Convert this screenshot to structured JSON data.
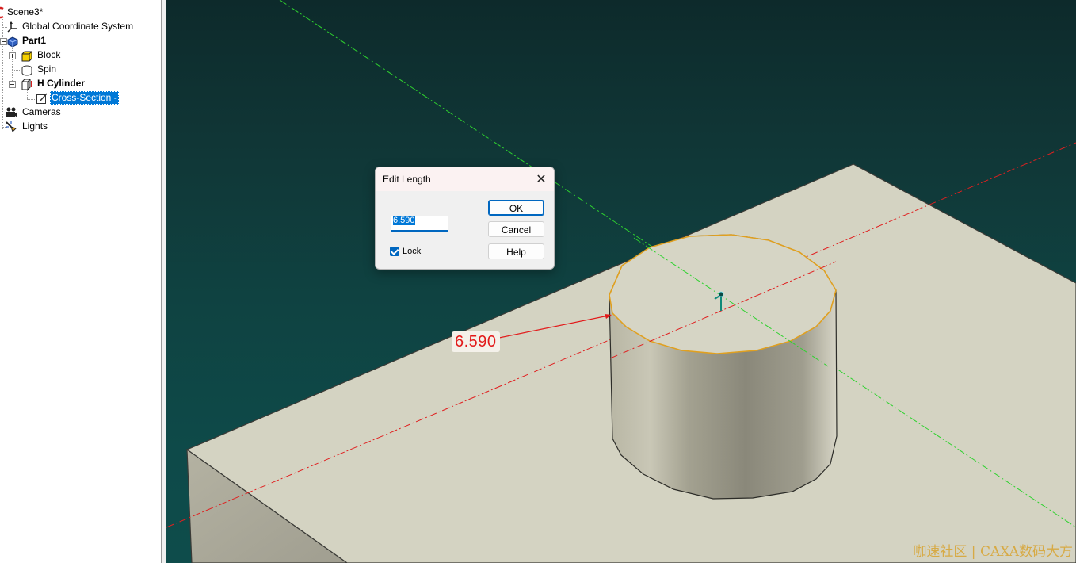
{
  "tree": {
    "items": [
      {
        "label": "Scene3*",
        "icon": "scene-icon",
        "bold": false
      },
      {
        "label": "Global Coordinate System",
        "icon": "axes-icon",
        "bold": false
      },
      {
        "label": "Part1",
        "icon": "part-icon",
        "bold": true
      },
      {
        "label": "Block",
        "icon": "block-icon",
        "bold": false
      },
      {
        "label": "Spin",
        "icon": "spin-icon",
        "bold": false
      },
      {
        "label": "H Cylinder",
        "icon": "cylinder-icon",
        "bold": true
      },
      {
        "label": "Cross-Section -",
        "icon": "sketch-icon",
        "bold": false,
        "selected": true
      },
      {
        "label": "Cameras",
        "icon": "camera-icon",
        "bold": false
      },
      {
        "label": "Lights",
        "icon": "light-icon",
        "bold": false
      }
    ]
  },
  "viewport": {
    "dimension_label": "6.590",
    "watermark": "咖速社区 | CAXA数码大方"
  },
  "dialog": {
    "title": "Edit Length",
    "close_glyph": "✕",
    "length_value": "6.590",
    "lock_label": "Lock",
    "lock_checked": true,
    "ok_label": "OK",
    "cancel_label": "Cancel",
    "help_label": "Help"
  },
  "colors": {
    "selection": "#0078d7",
    "dimension_red": "#e21a1a",
    "edge_orange": "#e0a020",
    "axis_green": "#2fd22f"
  }
}
